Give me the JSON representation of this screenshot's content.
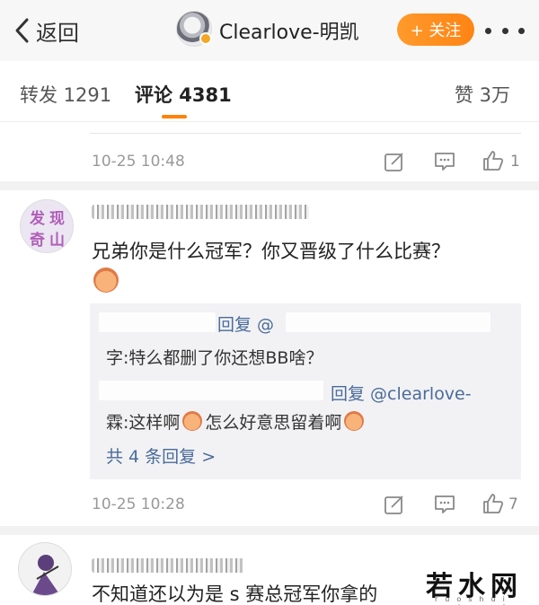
{
  "nav": {
    "back_label": "返回",
    "username": "Clearlove-明凯",
    "follow_label": "+ 关注"
  },
  "tabs": {
    "repost": "转发 1291",
    "comments": "评论 4381",
    "likes": "赞 3万"
  },
  "post_meta": {
    "time": "10-25 10:48",
    "like_count": "1"
  },
  "comment1": {
    "avatar_text": [
      "发",
      "现",
      "奇",
      "山"
    ],
    "text": "兄弟你是什么冠军？你又晋级了什么比赛？",
    "replies": [
      {
        "prefix": "回复 @",
        "cont": "字:特么都删了你还想BB啥？"
      },
      {
        "prefix": "回复 @clearlove-",
        "cont": "霖:这样啊",
        "cont2": "怎么好意思留着啊"
      }
    ],
    "more_replies": "共 4 条回复 >",
    "time": "10-25 10:28",
    "like_count": "7"
  },
  "comment2": {
    "text": "不知道还以为是 s 赛总冠军你拿的"
  },
  "watermark": {
    "text": "若水网",
    "sub": "ruoshui network"
  },
  "colors": {
    "accent": "#ff8200",
    "link": "#4a6b9a",
    "follow_bg": "#ff8a1c"
  },
  "icons": {
    "back": "chevron-left-icon",
    "repost": "repost-icon",
    "comment": "comment-icon",
    "like": "thumbs-up-icon",
    "more": "more-dots-icon"
  }
}
